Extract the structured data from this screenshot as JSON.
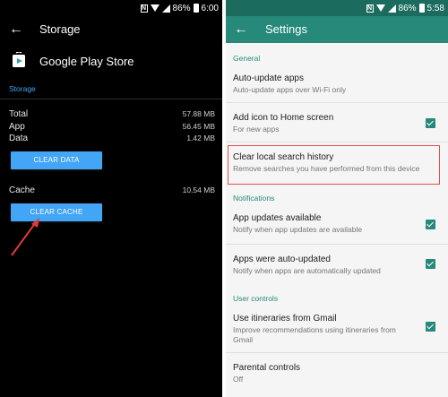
{
  "left": {
    "status": {
      "battery_pct": "86%",
      "time": "6:00",
      "n_icon": "N"
    },
    "appbar": {
      "title": "Storage",
      "back_icon": "back-arrow-icon"
    },
    "app": {
      "name": "Google Play Store",
      "icon": "play-store-icon"
    },
    "storage_header": "Storage",
    "rows": [
      {
        "label": "Total",
        "value": "57.88 MB"
      },
      {
        "label": "App",
        "value": "56.45 MB"
      },
      {
        "label": "Data",
        "value": "1.42 MB"
      }
    ],
    "clear_data_label": "CLEAR DATA",
    "cache": {
      "label": "Cache",
      "value": "10.54 MB"
    },
    "clear_cache_label": "CLEAR CACHE",
    "arrow_color": "#e53935",
    "accent": "#42a5f5"
  },
  "right": {
    "status": {
      "battery_pct": "86%",
      "time": "5:58",
      "n_icon": "N"
    },
    "appbar": {
      "title": "Settings",
      "back_icon": "back-arrow-icon"
    },
    "sections": {
      "general": "General",
      "notifications": "Notifications",
      "user_controls": "User controls"
    },
    "items": {
      "auto_update": {
        "title": "Auto-update apps",
        "subtitle": "Auto-update apps over Wi-Fi only"
      },
      "add_icon": {
        "title": "Add icon to Home screen",
        "subtitle": "For new apps",
        "checked": true
      },
      "clear_history": {
        "title": "Clear local search history",
        "subtitle": "Remove searches you have performed from this device"
      },
      "app_updates": {
        "title": "App updates available",
        "subtitle": "Notify when app updates are available",
        "checked": true
      },
      "auto_updated": {
        "title": "Apps were auto-updated",
        "subtitle": "Notify when apps are automatically updated",
        "checked": true
      },
      "itineraries": {
        "title": "Use itineraries from Gmail",
        "subtitle": "Improve recommendations using itineraries from Gmail",
        "checked": true
      },
      "parental": {
        "title": "Parental controls",
        "subtitle": "Off"
      }
    },
    "accent": "#26897a",
    "highlight_color": "#e05050"
  }
}
